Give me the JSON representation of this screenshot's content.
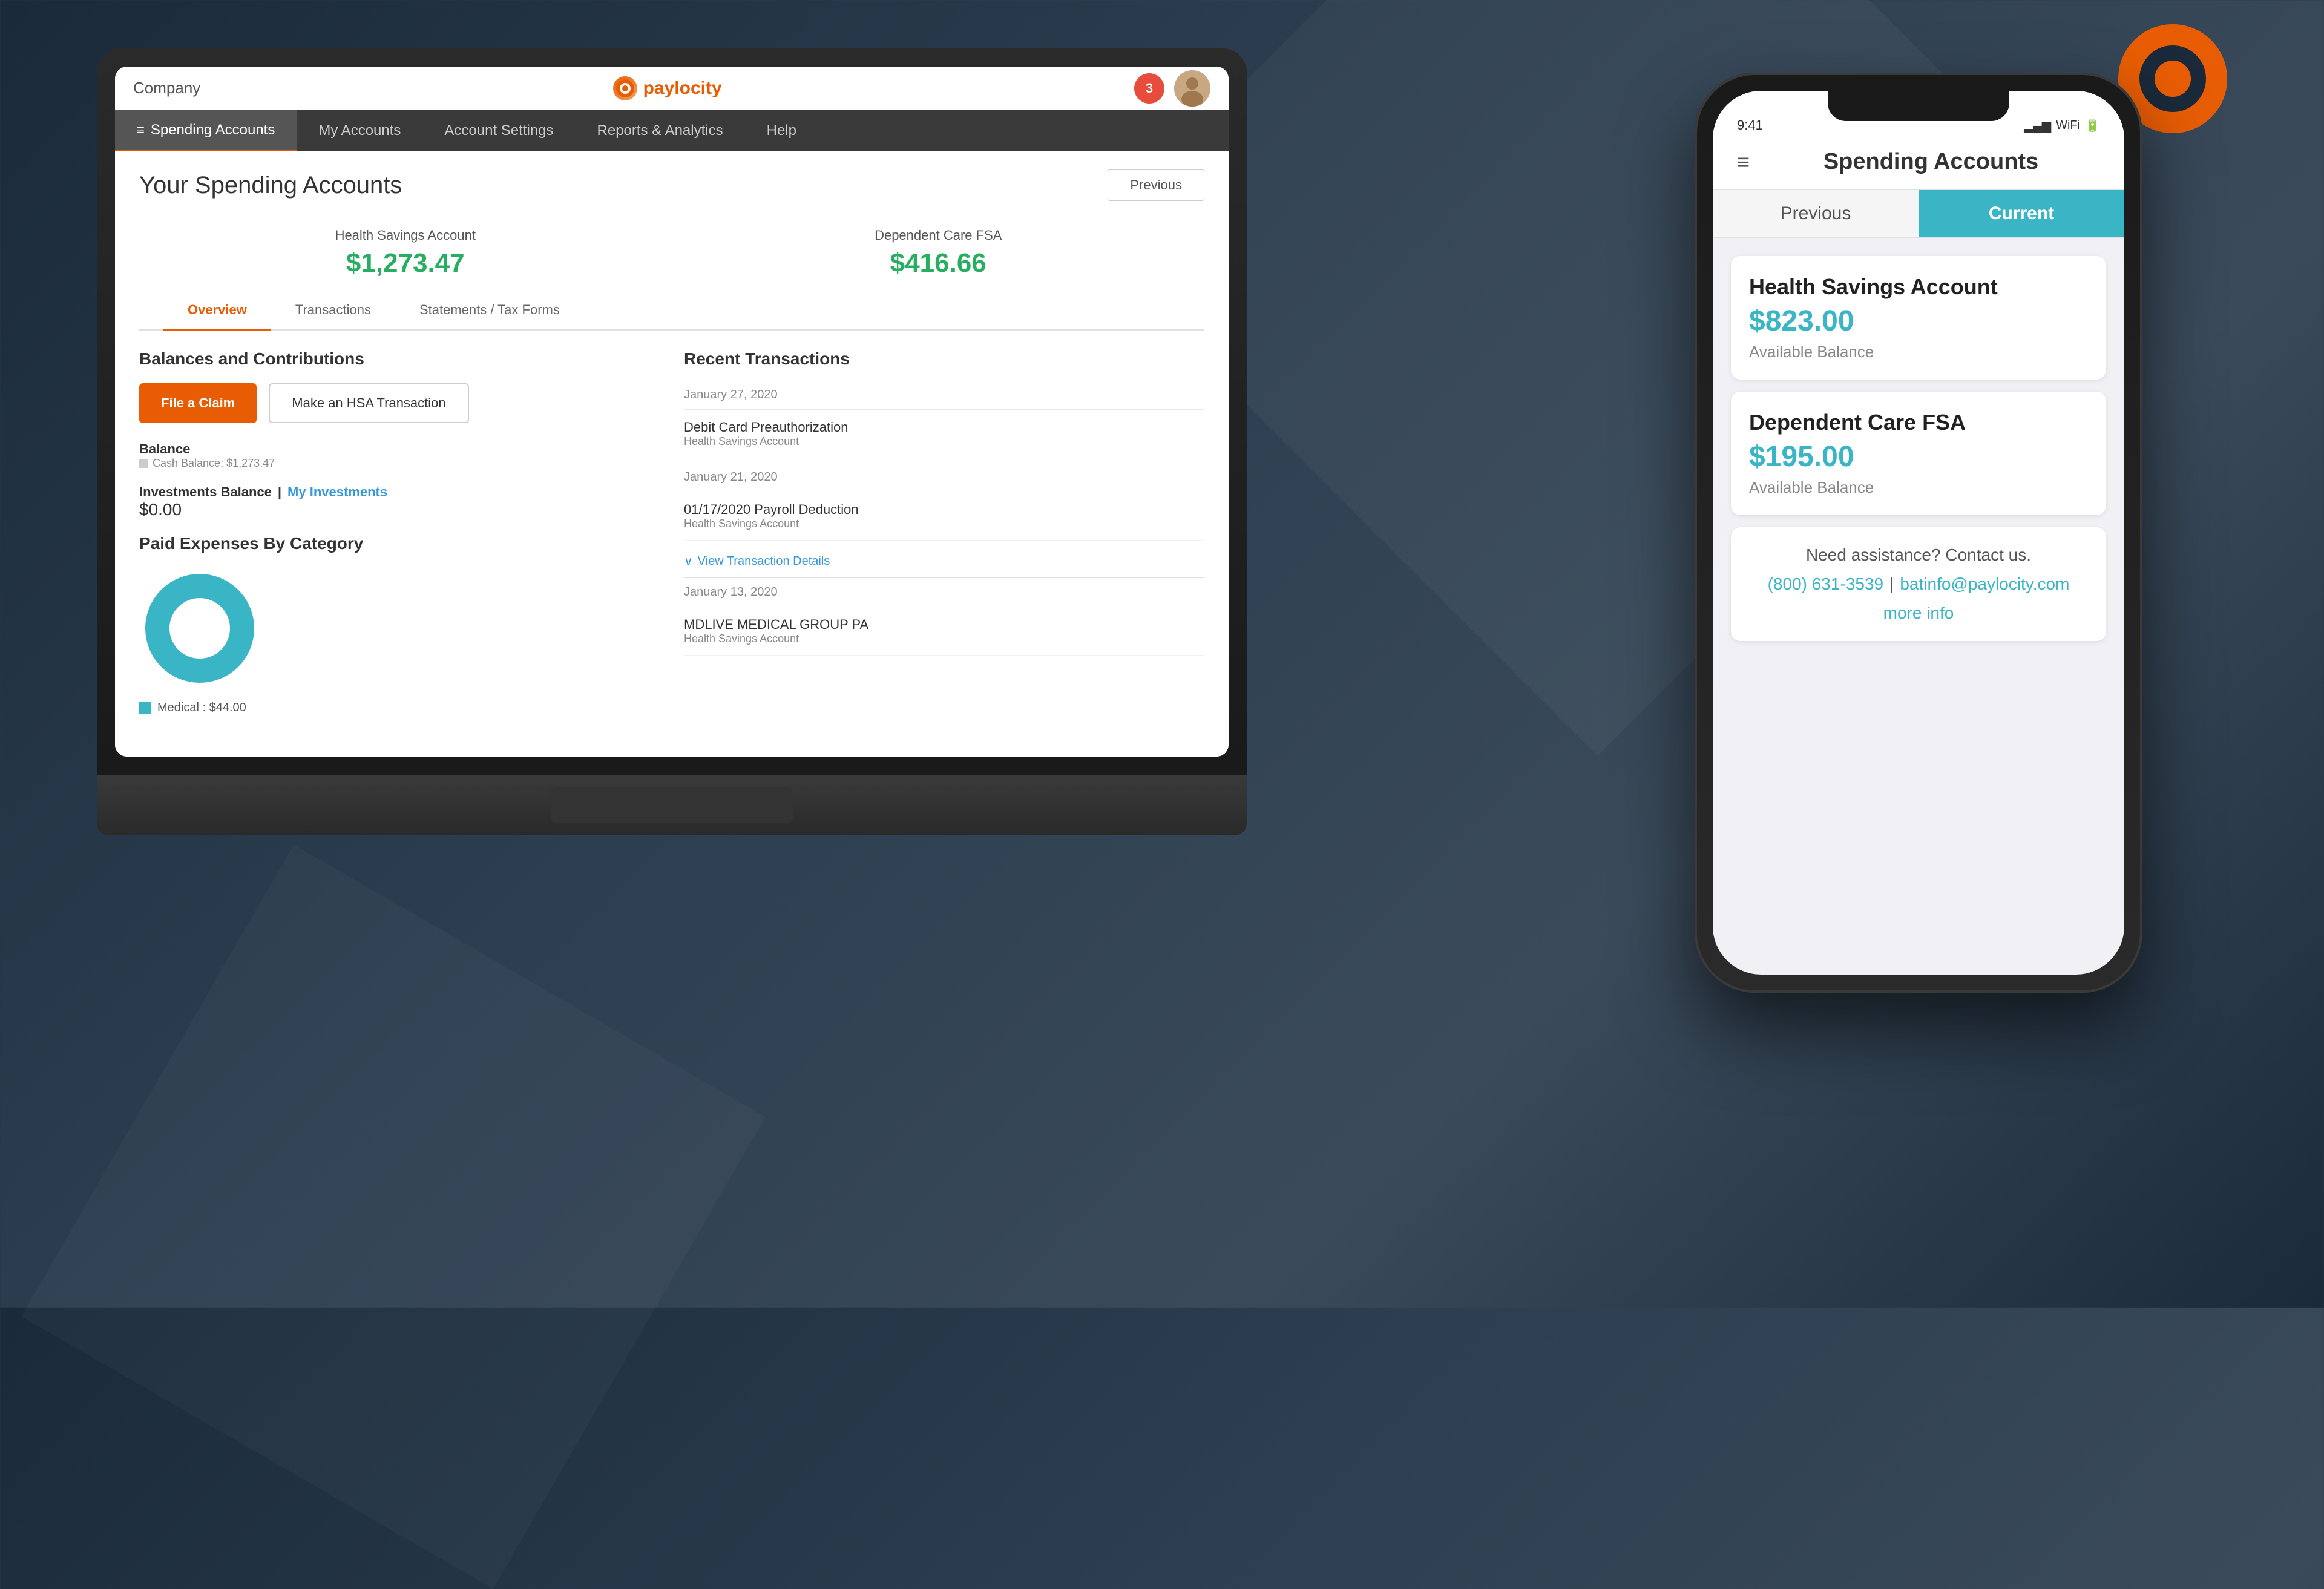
{
  "background": {
    "color": "#1a2a3a"
  },
  "paylocity_logo_corner": {
    "aria": "paylocity-logo"
  },
  "laptop": {
    "top_bar": {
      "company_label": "Company",
      "brand_name": "paylocity",
      "notification_count": "3"
    },
    "nav": {
      "items": [
        {
          "label": "Spending Accounts",
          "active": true,
          "icon": "≡"
        },
        {
          "label": "My Accounts",
          "active": false
        },
        {
          "label": "Account Settings",
          "active": false
        },
        {
          "label": "Reports & Analytics",
          "active": false
        },
        {
          "label": "Help",
          "active": false
        }
      ]
    },
    "page": {
      "title": "Your Spending Accounts",
      "previous_btn": "Previous",
      "account_cards": [
        {
          "label": "Health Savings Account",
          "amount": "$1,273.47"
        },
        {
          "label": "Dependent Care FSA",
          "amount": "$416.66"
        }
      ],
      "sub_tabs": [
        {
          "label": "Overview",
          "active": true
        },
        {
          "label": "Transactions",
          "active": false
        },
        {
          "label": "Statements / Tax Forms",
          "active": false
        }
      ],
      "left_panel": {
        "section_title": "Balances and Contributions",
        "file_claim_btn": "File a Claim",
        "hsa_transaction_btn": "Make an HSA Transaction",
        "balance": {
          "label": "Balance",
          "cash_balance_label": "Cash Balance: $1,273.47"
        },
        "investments": {
          "label": "Investments Balance",
          "link_label": "My Investments",
          "separator": "|",
          "amount": "$0.00"
        },
        "expenses": {
          "label": "Paid Expenses By Category",
          "chart_data": [
            {
              "category": "Medical",
              "amount": "$44.00",
              "color": "#3ab5c6",
              "percentage": 100
            }
          ]
        }
      },
      "right_panel": {
        "section_title": "Recent Transactions",
        "transaction_groups": [
          {
            "date": "January 27, 2020",
            "transactions": [
              {
                "name": "Debit Card Preauthorization",
                "account": "Health Savings Account"
              }
            ]
          },
          {
            "date": "January 21, 2020",
            "transactions": [
              {
                "name": "01/17/2020 Payroll Deduction",
                "account": "Health Savings Account"
              }
            ]
          },
          {
            "date": "January 13, 2020",
            "transactions": [
              {
                "name": "MDLIVE MEDICAL GROUP PA",
                "account": "Health Savings Account"
              }
            ]
          }
        ],
        "view_details_btn": "View Transaction Details"
      }
    }
  },
  "phone": {
    "header": {
      "title": "Spending Accounts",
      "hamburger_icon": "≡"
    },
    "tabs": [
      {
        "label": "Previous",
        "active": false
      },
      {
        "label": "Current",
        "active": true
      }
    ],
    "accounts": [
      {
        "name": "Health Savings Account",
        "amount": "$823.00",
        "balance_label": "Available Balance"
      },
      {
        "name": "Dependent Care FSA",
        "amount": "$195.00",
        "balance_label": "Available Balance"
      }
    ],
    "contact": {
      "title": "Need assistance? Contact us.",
      "phone": "(800) 631-3539",
      "separator": "|",
      "email": "batinfo@paylocity.com",
      "more_info": "more info"
    }
  }
}
